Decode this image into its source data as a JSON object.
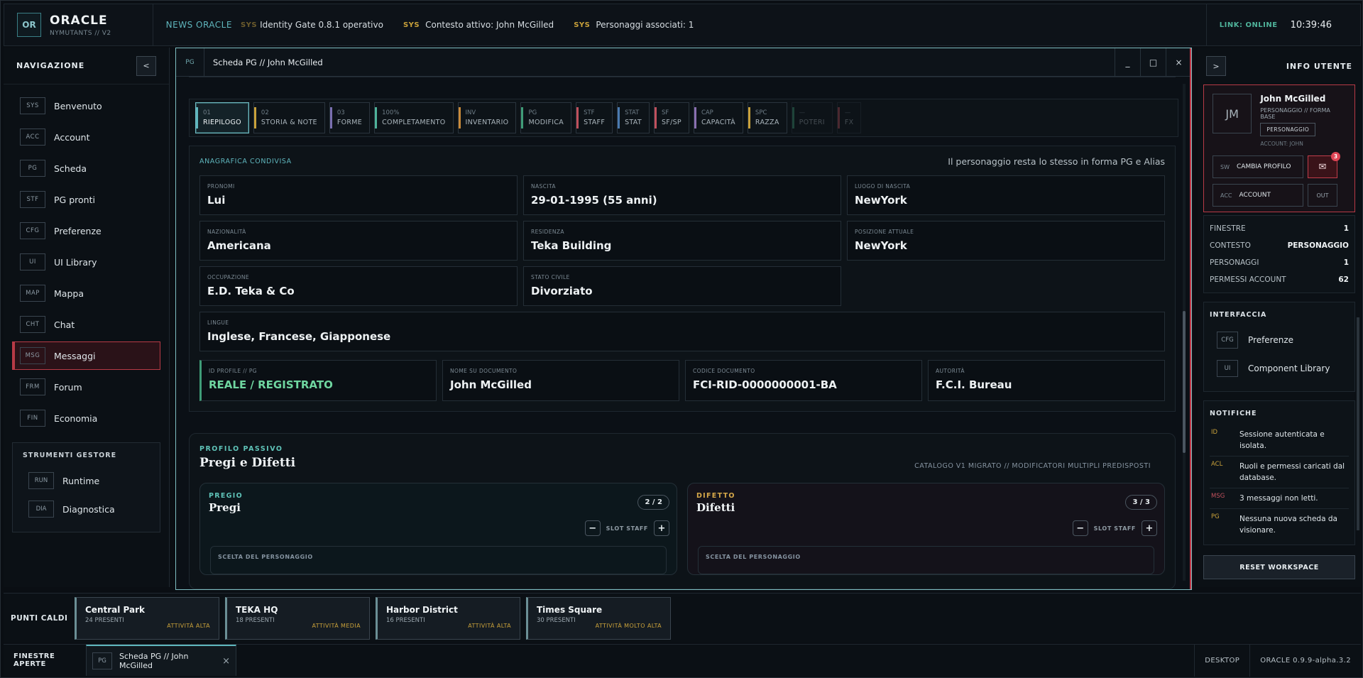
{
  "topbar": {
    "logo": "OR",
    "brand_title": "ORACLE",
    "brand_sub": "NYMUTANTS // V2",
    "news_label": "NEWS ORACLE",
    "ticker": [
      {
        "tag": "SYS",
        "text": "Identity Gate 0.8.1 operativo"
      },
      {
        "tag": "SYS",
        "text": "Contesto attivo: John McGilled"
      },
      {
        "tag": "SYS",
        "text": "Personaggi associati: 1"
      }
    ],
    "link_status": "LINK: ONLINE",
    "clock": "10:39:46"
  },
  "leftnav": {
    "title": "NAVIGAZIONE",
    "collapse": "<",
    "items": [
      {
        "code": "SYS",
        "label": "Benvenuto"
      },
      {
        "code": "ACC",
        "label": "Account"
      },
      {
        "code": "PG",
        "label": "Scheda"
      },
      {
        "code": "STF",
        "label": "PG pronti"
      },
      {
        "code": "CFG",
        "label": "Preferenze"
      },
      {
        "code": "UI",
        "label": "UI Library"
      },
      {
        "code": "MAP",
        "label": "Mappa"
      },
      {
        "code": "CHT",
        "label": "Chat"
      },
      {
        "code": "MSG",
        "label": "Messaggi"
      },
      {
        "code": "FRM",
        "label": "Forum"
      },
      {
        "code": "FIN",
        "label": "Economia"
      }
    ],
    "tools_title": "STRUMENTI GESTORE",
    "tools": [
      {
        "code": "RUN",
        "label": "Runtime"
      },
      {
        "code": "DIA",
        "label": "Diagnostica"
      }
    ]
  },
  "window": {
    "code": "PG",
    "title": "Scheda PG // John McGilled",
    "min": "_",
    "max": "□",
    "close": "×",
    "tabs": [
      {
        "n": "01",
        "l": "RIEPILOGO",
        "color": "#5fb6bd"
      },
      {
        "n": "02",
        "l": "STORIA & NOTE",
        "color": "#c9a13a"
      },
      {
        "n": "03",
        "l": "FORME",
        "color": "#7a6fb0"
      },
      {
        "n": "100%",
        "l": "COMPLETAMENTO",
        "color": "#4fb39a"
      },
      {
        "n": "INV",
        "l": "INVENTARIO",
        "color": "#c98a3a"
      },
      {
        "n": "PG",
        "l": "MODIFICA",
        "color": "#3f9c77"
      },
      {
        "n": "STF",
        "l": "STAFF",
        "color": "#c0505c"
      },
      {
        "n": "STAT",
        "l": "STAT",
        "color": "#4a7ab0"
      },
      {
        "n": "SF",
        "l": "SF/SP",
        "color": "#c0505c"
      },
      {
        "n": "CAP",
        "l": "CAPACITÀ",
        "color": "#8a6fb0"
      },
      {
        "n": "SPC",
        "l": "RAZZA",
        "color": "#c9a13a"
      },
      {
        "n": "—",
        "l": "POTERI",
        "color": "#3f9c77"
      },
      {
        "n": "—",
        "l": "FX",
        "color": "#c0505c"
      }
    ],
    "anagrafica": {
      "title": "ANAGRAFICA CONDIVISA",
      "note": "Il personaggio resta lo stesso in forma PG e Alias",
      "fields": [
        {
          "k": "PRONOMI",
          "v": "Lui"
        },
        {
          "k": "NASCITA",
          "v": "29-01-1995 (55 anni)"
        },
        {
          "k": "LUOGO DI NASCITA",
          "v": "NewYork"
        },
        {
          "k": "NAZIONALITÀ",
          "v": "Americana"
        },
        {
          "k": "RESIDENZA",
          "v": "Teka Building"
        },
        {
          "k": "POSIZIONE ATTUALE",
          "v": "NewYork"
        },
        {
          "k": "OCCUPAZIONE",
          "v": "E.D. Teka & Co"
        },
        {
          "k": "STATO CIVILE",
          "v": "Divorziato"
        }
      ],
      "lingue": {
        "k": "LINGUE",
        "v": "Inglese, Francese, Giapponese"
      },
      "id_fields": [
        {
          "k": "ID PROFILE // PG",
          "v": "REALE / REGISTRATO"
        },
        {
          "k": "NOME SU DOCUMENTO",
          "v": "John McGilled"
        },
        {
          "k": "CODICE DOCUMENTO",
          "v": "FCI-RID-0000000001-BA"
        },
        {
          "k": "AUTORITÀ",
          "v": "F.C.I. Bureau"
        }
      ]
    },
    "passive": {
      "kicker": "PROFILO PASSIVO",
      "title": "Pregi e Difetti",
      "meta": "CATALOGO V1 MIGRATO // MODIFICATORI MULTIPLI PREDISPOSTI",
      "cards": [
        {
          "kicker": "PREGIO",
          "title": "Pregi",
          "count": "2 / 2",
          "slot": "SLOT STAFF",
          "choice": "SCELTA DEL PERSONAGGIO",
          "color": "#5fc3b8"
        },
        {
          "kicker": "DIFETTO",
          "title": "Difetti",
          "count": "3 / 3",
          "slot": "SLOT STAFF",
          "choice": "SCELTA DEL PERSONAGGIO",
          "color": "#d7a94a"
        }
      ]
    }
  },
  "rightnav": {
    "expand": ">",
    "title": "INFO UTENTE",
    "user": {
      "initials": "JM",
      "name": "John McGilled",
      "role": "PERSONAGGIO // FORMA BASE",
      "badge": "PERSONAGGIO",
      "account": "ACCOUNT: JOHN",
      "switch_code": "SW",
      "switch_label": "CAMBIA PROFILO",
      "mail_count": "3",
      "acc_code": "ACC",
      "acc_label": "ACCOUNT",
      "out": "OUT"
    },
    "stats": [
      {
        "k": "FINESTRE",
        "v": "1"
      },
      {
        "k": "CONTESTO",
        "v": "PERSONAGGIO"
      },
      {
        "k": "PERSONAGGI",
        "v": "1"
      },
      {
        "k": "PERMESSI ACCOUNT",
        "v": "62"
      }
    ],
    "interfaccia_title": "INTERFACCIA",
    "interfaccia": [
      {
        "code": "CFG",
        "label": "Preferenze"
      },
      {
        "code": "UI",
        "label": "Component Library"
      }
    ],
    "notifiche_title": "NOTIFICHE",
    "notifiche": [
      {
        "code": "ID",
        "text": "Sessione autenticata e isolata."
      },
      {
        "code": "ACL",
        "text": "Ruoli e permessi caricati dal database."
      },
      {
        "code": "MSG",
        "text": "3 messaggi non letti."
      },
      {
        "code": "PG",
        "text": "Nessuna nuova scheda da visionare."
      }
    ],
    "reset": "RESET WORKSPACE"
  },
  "hotspots": {
    "label": "PUNTI CALDI",
    "items": [
      {
        "name": "Central Park",
        "presenti": "24 PRESENTI",
        "attivita": "ATTIVITÀ ALTA"
      },
      {
        "name": "TEKA HQ",
        "presenti": "18 PRESENTI",
        "attivita": "ATTIVITÀ MEDIA"
      },
      {
        "name": "Harbor District",
        "presenti": "16 PRESENTI",
        "attivita": "ATTIVITÀ ALTA"
      },
      {
        "name": "Times Square",
        "presenti": "30 PRESENTI",
        "attivita": "ATTIVITÀ MOLTO ALTA"
      }
    ]
  },
  "taskbar": {
    "label": "FINESTRE APERTE",
    "task_code": "PG",
    "task_title": "Scheda PG // John McGilled",
    "task_close": "×",
    "desktop": "DESKTOP",
    "version": "ORACLE 0.9.9-alpha.3.2"
  }
}
